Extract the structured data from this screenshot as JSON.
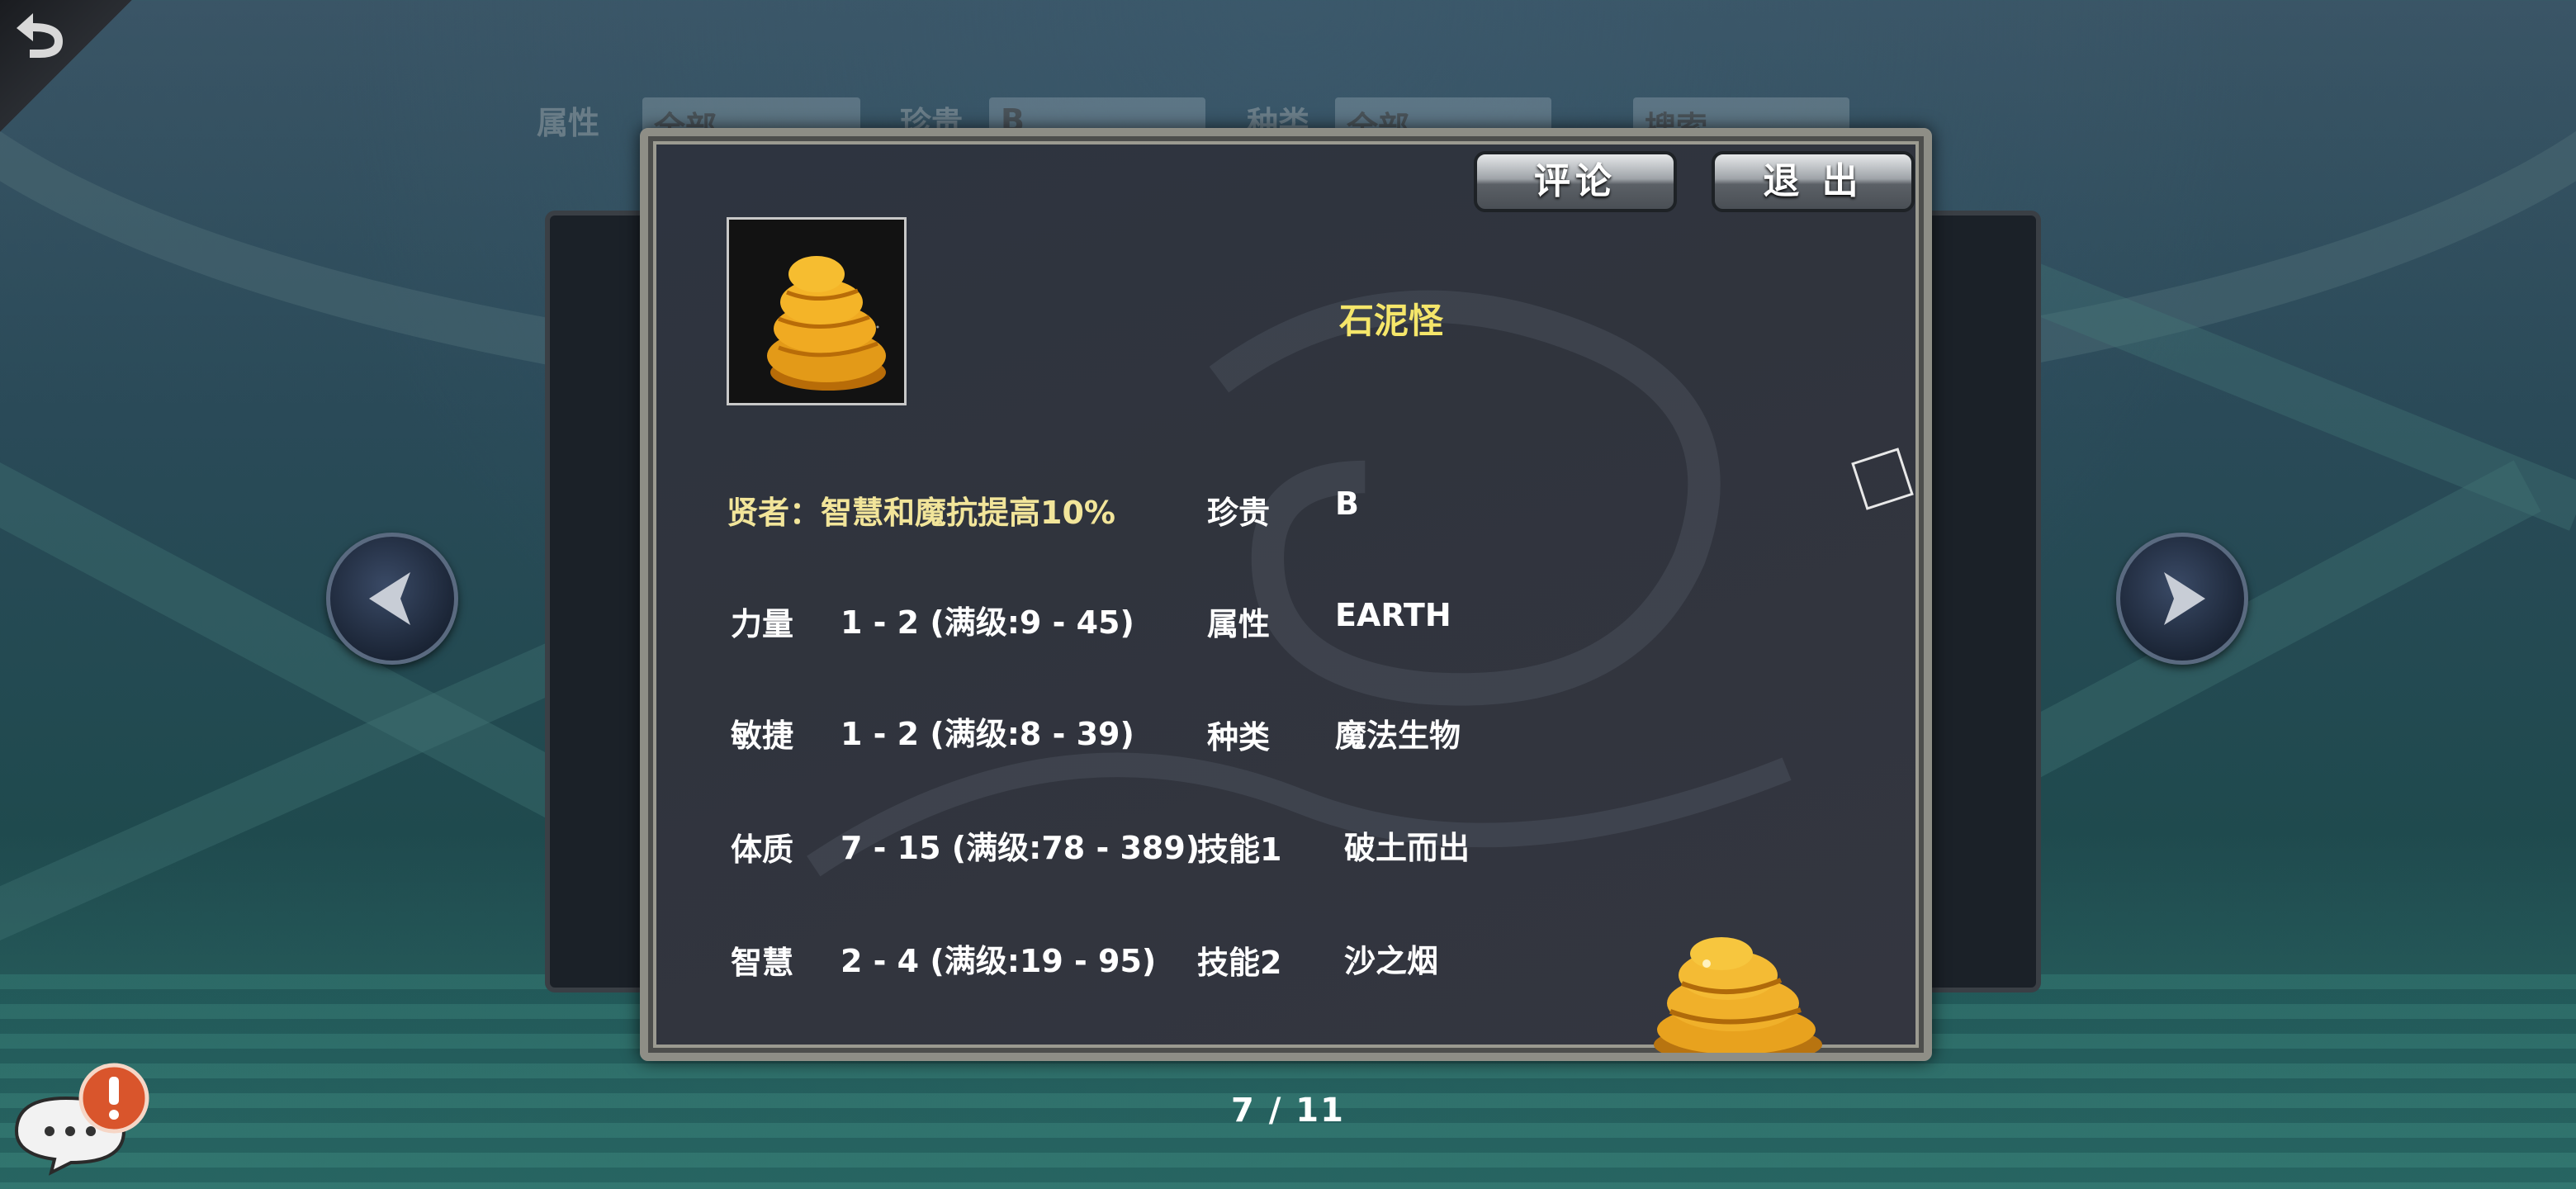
{
  "filters": {
    "attribute_label": "属性",
    "attribute_value": "全部",
    "rarity_label": "珍贵",
    "rarity_value": "B",
    "type_label": "种类",
    "type_value": "全部",
    "search_value": "搜索"
  },
  "dialog": {
    "comment_button": "评论",
    "exit_button": "退 出",
    "monster_name": "石泥怪",
    "trait": "贤者：智慧和魔抗提高10%",
    "stats": [
      {
        "label": "力量",
        "value": "1 - 2 (满级:9 - 45)"
      },
      {
        "label": "敏捷",
        "value": "1 - 2 (满级:8 - 39)"
      },
      {
        "label": "体质",
        "value": "7 - 15 (满级:78 - 389)"
      },
      {
        "label": "智慧",
        "value": "2 - 4 (满级:19 - 95)"
      }
    ],
    "info": [
      {
        "label": "珍贵",
        "value": "B"
      },
      {
        "label": "属性",
        "value": "EARTH"
      },
      {
        "label": "种类",
        "value": "魔法生物"
      },
      {
        "label": "技能1",
        "value": "破土而出"
      },
      {
        "label": "技能2",
        "value": "沙之烟"
      }
    ]
  },
  "pager": "7 / 11",
  "icons": {
    "back": "back-arrow-icon",
    "prev": "left-arrow-icon",
    "next": "right-arrow-icon",
    "chat": "chat-bubble-icon",
    "alert": "exclamation-icon"
  },
  "colors": {
    "name": "#f5e66a",
    "trait": "#f2e59a",
    "alert": "#d9552c"
  }
}
